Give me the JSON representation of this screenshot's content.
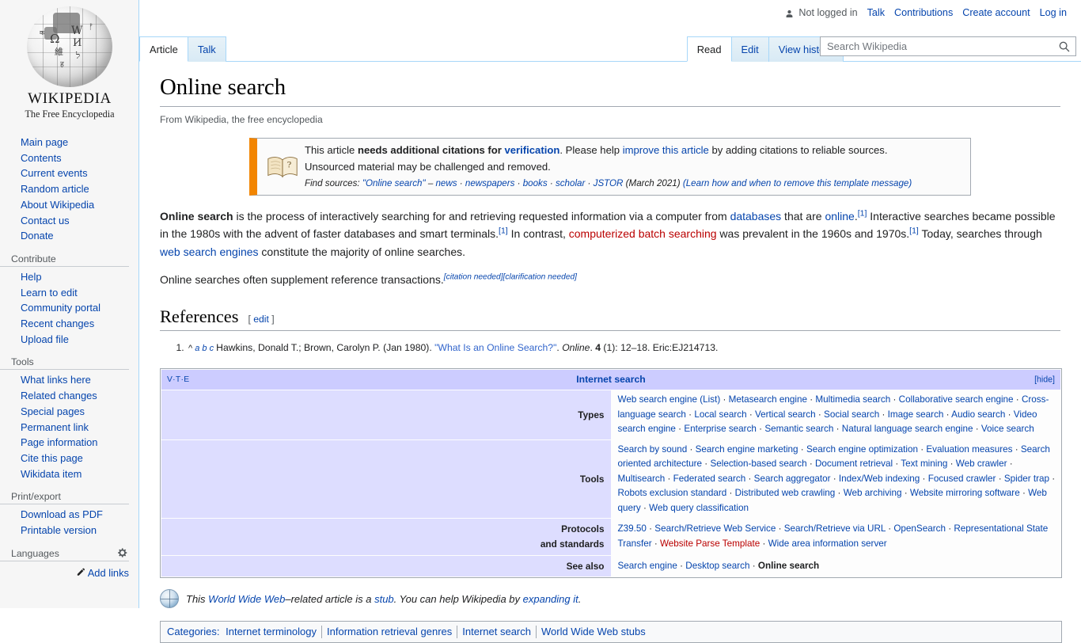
{
  "personal_bar": {
    "user_status": "Not logged in",
    "user_icon": "person-icon",
    "links": [
      "Talk",
      "Contributions",
      "Create account",
      "Log in"
    ]
  },
  "sidebar": {
    "logo": {
      "wordmark": "WIKIPEDIA",
      "tagline": "The Free Encyclopedia",
      "globe_glyphs": [
        "W",
        "Ω",
        "И",
        "維",
        "ל",
        "क",
        "文"
      ]
    },
    "portals": [
      {
        "heading": "",
        "items": [
          "Main page",
          "Contents",
          "Current events",
          "Random article",
          "About Wikipedia",
          "Contact us",
          "Donate"
        ]
      },
      {
        "heading": "Contribute",
        "items": [
          "Help",
          "Learn to edit",
          "Community portal",
          "Recent changes",
          "Upload file"
        ]
      },
      {
        "heading": "Tools",
        "items": [
          "What links here",
          "Related changes",
          "Special pages",
          "Permanent link",
          "Page information",
          "Cite this page",
          "Wikidata item"
        ]
      },
      {
        "heading": "Print/export",
        "items": [
          "Download as PDF",
          "Printable version"
        ]
      }
    ],
    "languages": {
      "heading": "Languages",
      "gear_icon": "gear-icon",
      "add_links": "Add links",
      "pencil_icon": "pencil-icon"
    }
  },
  "namespace_tabs": [
    {
      "label": "Article",
      "selected": true
    },
    {
      "label": "Talk",
      "selected": false
    }
  ],
  "view_tabs": [
    {
      "label": "Read",
      "selected": true
    },
    {
      "label": "Edit",
      "selected": false
    },
    {
      "label": "View history",
      "selected": false
    }
  ],
  "search": {
    "placeholder": "Search Wikipedia",
    "value": "",
    "icon": "search-icon"
  },
  "article": {
    "title": "Online search",
    "site_sub": "From Wikipedia, the free encyclopedia",
    "ambox": {
      "icon": "open-book-question-icon",
      "line1_a": "This article ",
      "line1_bold": "needs additional citations for ",
      "line1_bold_link": "verification",
      "line1_b": ". Please help ",
      "line1_link2": "improve this article",
      "line1_c": " by adding citations to reliable sources.",
      "line2": "Unsourced material may be challenged and removed.",
      "find_sources_label": "Find sources:",
      "find_sources_query": "\"Online search\"",
      "find_sources_dash": " – ",
      "find_sources_links": [
        "news",
        "newspapers",
        "books",
        "scholar",
        "JSTOR"
      ],
      "date": "(March 2021)",
      "remove_note": "(Learn how and when to remove this template message)"
    },
    "paragraphs": [
      {
        "parts": [
          {
            "t": "b",
            "text": "Online search"
          },
          {
            "t": "p",
            "text": " is the process of interactively searching for and retrieving requested information via a computer from "
          },
          {
            "t": "a",
            "text": "databases"
          },
          {
            "t": "p",
            "text": " that are "
          },
          {
            "t": "a",
            "text": "online"
          },
          {
            "t": "p",
            "text": "."
          },
          {
            "t": "ref",
            "text": "[1]"
          },
          {
            "t": "p",
            "text": " Interactive searches became possible in the 1980s with the advent of faster databases and smart terminals."
          },
          {
            "t": "ref",
            "text": "[1]"
          },
          {
            "t": "p",
            "text": " In contrast, "
          },
          {
            "t": "ar",
            "text": "computerized batch searching"
          },
          {
            "t": "p",
            "text": " was prevalent in the 1960s and 1970s."
          },
          {
            "t": "ref",
            "text": "[1]"
          },
          {
            "t": "p",
            "text": " Today, searches through "
          },
          {
            "t": "a",
            "text": "web search engines"
          },
          {
            "t": "p",
            "text": " constitute the majority of online searches."
          }
        ]
      },
      {
        "parts": [
          {
            "t": "p",
            "text": "Online searches often supplement reference transactions."
          },
          {
            "t": "need",
            "text": "[citation needed]"
          },
          {
            "t": "need",
            "text": "[clarification needed]"
          }
        ]
      }
    ],
    "references_heading": "References",
    "edit_section": "[ edit ]",
    "edit_label": "edit",
    "references": [
      {
        "backlink_caret": "^",
        "backlinks": [
          "a",
          "b",
          "c"
        ],
        "text_before_title": "Hawkins, Donald T.; Brown, Carolyn P. (Jan 1980). ",
        "title": "\"What Is an Online Search?\"",
        "journal": "Online",
        "volume": "4",
        "issue": "(1)",
        "pages": "12–18",
        "identifier": "Eric:EJ214713",
        "full": "Hawkins, Donald T.; Brown, Carolyn P. (Jan 1980). \"What Is an Online Search?\". Online. 4 (1): 12–18. Eric:EJ214713."
      }
    ]
  },
  "navbox": {
    "vte": [
      "V",
      "T",
      "E"
    ],
    "vte_sep": "·",
    "title": "Internet search",
    "hide_label": "[hide]",
    "rows": [
      {
        "group": "Types",
        "items": [
          {
            "text": "Web search engine (List)",
            "red": false
          },
          {
            "text": "Metasearch engine",
            "red": false
          },
          {
            "text": "Multimedia search",
            "red": false
          },
          {
            "text": "Collaborative search engine",
            "red": false
          },
          {
            "text": "Cross-language search",
            "red": false
          },
          {
            "text": "Local search",
            "red": false
          },
          {
            "text": "Vertical search",
            "red": false
          },
          {
            "text": "Social search",
            "red": false
          },
          {
            "text": "Image search",
            "red": false
          },
          {
            "text": "Audio search",
            "red": false
          },
          {
            "text": "Video search engine",
            "red": false
          },
          {
            "text": "Enterprise search",
            "red": false
          },
          {
            "text": "Semantic search",
            "red": false
          },
          {
            "text": "Natural language search engine",
            "red": false
          },
          {
            "text": "Voice search",
            "red": false
          }
        ]
      },
      {
        "group": "Tools",
        "items": [
          {
            "text": "Search by sound",
            "red": false
          },
          {
            "text": "Search engine marketing",
            "red": false
          },
          {
            "text": "Search engine optimization",
            "red": false
          },
          {
            "text": "Evaluation measures",
            "red": false
          },
          {
            "text": "Search oriented architecture",
            "red": false
          },
          {
            "text": "Selection-based search",
            "red": false
          },
          {
            "text": "Document retrieval",
            "red": false
          },
          {
            "text": "Text mining",
            "red": false
          },
          {
            "text": "Web crawler",
            "red": false
          },
          {
            "text": "Multisearch",
            "red": false
          },
          {
            "text": "Federated search",
            "red": false
          },
          {
            "text": "Search aggregator",
            "red": false
          },
          {
            "text": "Index/Web indexing",
            "red": false
          },
          {
            "text": "Focused crawler",
            "red": false
          },
          {
            "text": "Spider trap",
            "red": false
          },
          {
            "text": "Robots exclusion standard",
            "red": false
          },
          {
            "text": "Distributed web crawling",
            "red": false
          },
          {
            "text": "Web archiving",
            "red": false
          },
          {
            "text": "Website mirroring software",
            "red": false
          },
          {
            "text": "Web query",
            "red": false
          },
          {
            "text": "Web query classification",
            "red": false
          }
        ]
      },
      {
        "group": "Protocols and standards",
        "group_line1": "Protocols",
        "group_line2": "and standards",
        "items": [
          {
            "text": "Z39.50",
            "red": false
          },
          {
            "text": "Search/Retrieve Web Service",
            "red": false
          },
          {
            "text": "Search/Retrieve via URL",
            "red": false
          },
          {
            "text": "OpenSearch",
            "red": false
          },
          {
            "text": "Representational State Transfer",
            "red": false
          },
          {
            "text": "Website Parse Template",
            "red": true
          },
          {
            "text": "Wide area information server",
            "red": false
          }
        ]
      },
      {
        "group": "See also",
        "items": [
          {
            "text": "Search engine",
            "red": false
          },
          {
            "text": "Desktop search",
            "red": false
          },
          {
            "text": "Online search",
            "red": false,
            "self": true
          }
        ]
      }
    ]
  },
  "stub": {
    "icon": "globe-icon",
    "before": "This ",
    "link": "World Wide Web",
    "middle": "–related article is a ",
    "stub_link": "stub",
    "after": ". You can help Wikipedia by ",
    "expand_link": "expanding it",
    "end": "."
  },
  "categories": {
    "label": "Categories:",
    "items": [
      "Internet terminology",
      "Information retrieval genres",
      "Internet search",
      "World Wide Web stubs"
    ]
  },
  "colors": {
    "link": "#0645ad",
    "link_red": "#ba0000",
    "navbox_title_bg": "#ccccff",
    "navbox_group_bg": "#ddddff",
    "ambox_accent": "#f28500",
    "tab_border": "#a7d7f9",
    "sidebar_bg": "#f6f6f6"
  }
}
